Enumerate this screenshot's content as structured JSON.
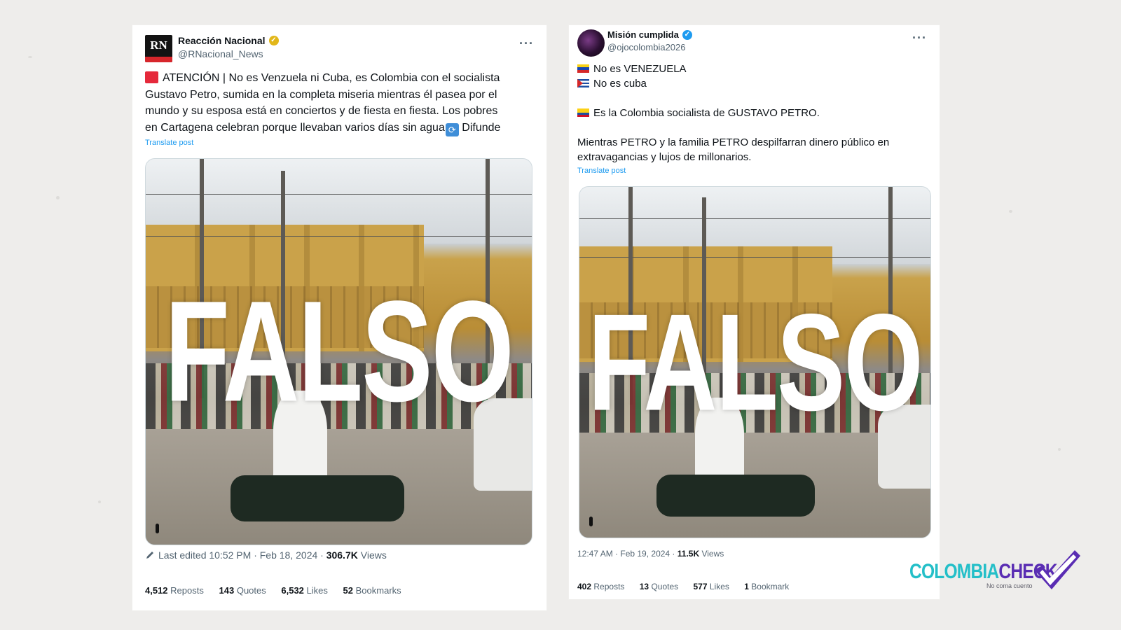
{
  "left_tweet": {
    "display_name": "Reacción Nacional",
    "handle": "@RNacional_News",
    "avatar_text": "RN",
    "body_lines": [
      "ATENCIÓN | No es Venzuela ni Cuba, es Colombia con el socialista",
      "Gustavo Petro, sumida en la completa miseria mientras él pasea por el",
      "mundo y su esposa está en conciertos y de fiesta en fiesta. Los pobres",
      "en Cartagena celebran porque llevaban varios días sin agua",
      "Difunde"
    ],
    "translate_label": "Translate post",
    "overlay_text": "FALSO",
    "meta_prefix": "Last edited 10:52 PM · Feb 18, 2024 ·",
    "views_count": "306.7K",
    "views_label": "Views",
    "stats": [
      {
        "count": "4,512",
        "label": "Reposts"
      },
      {
        "count": "143",
        "label": "Quotes"
      },
      {
        "count": "6,532",
        "label": "Likes"
      },
      {
        "count": "52",
        "label": "Bookmarks"
      }
    ],
    "verified_color": "#e2b719"
  },
  "right_tweet": {
    "display_name": "Misión cumplida",
    "handle": "@ojocolombia2026",
    "body_lines": [
      "No es VENEZUELA",
      "No es cuba",
      "Es la Colombia socialista de GUSTAVO PETRO.",
      "Mientras PETRO  y la familia PETRO despilfarran dinero público en",
      "extravagancias y lujos de millonarios."
    ],
    "translate_label": "Translate post",
    "overlay_text": "FALSO",
    "meta_prefix": "12:47 AM · Feb 19, 2024 ·",
    "views_count": "11.5K",
    "views_label": "Views",
    "stats": [
      {
        "count": "402",
        "label": "Reposts"
      },
      {
        "count": "13",
        "label": "Quotes"
      },
      {
        "count": "577",
        "label": "Likes"
      },
      {
        "count": "1",
        "label": "Bookmark"
      }
    ],
    "verified_color": "#1d9bf0"
  },
  "brand": {
    "part1": "COLOMBIA",
    "part2": "CHECK",
    "tagline": "No coma cuento",
    "colors": {
      "cyan": "#24bfc8",
      "purple": "#5a2db3"
    }
  }
}
